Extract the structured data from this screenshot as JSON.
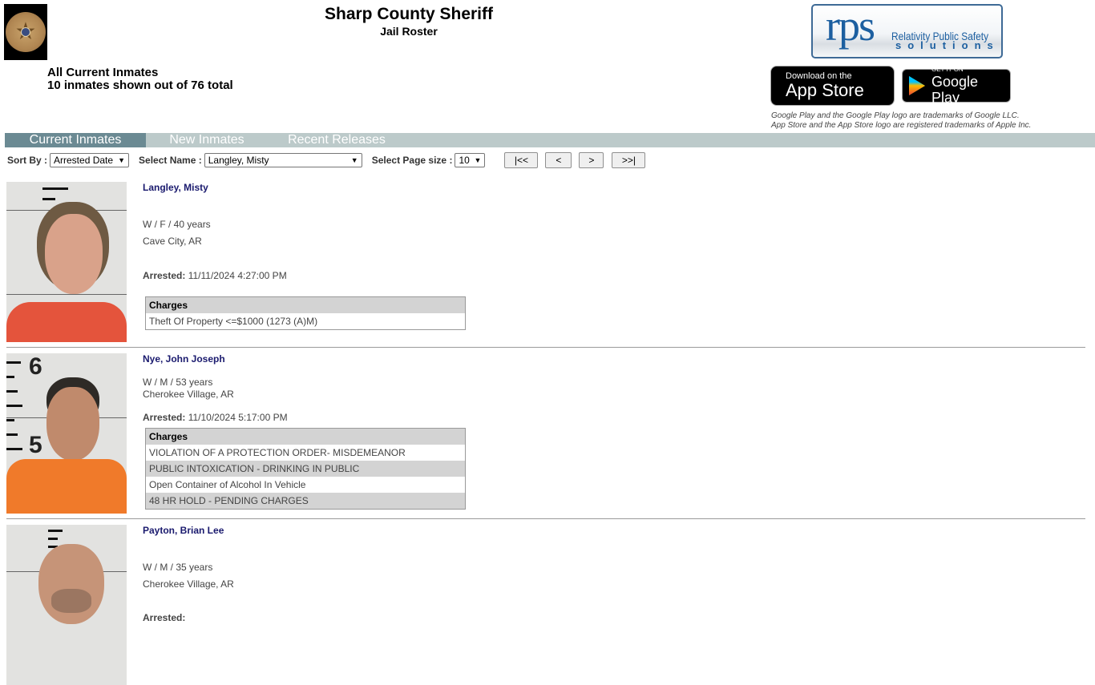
{
  "header": {
    "title": "Sharp County Sheriff",
    "subtitle": "Jail Roster",
    "summary_line1": "All Current Inmates",
    "summary_line2": "10 inmates shown out of 76 total"
  },
  "vendor": {
    "rps_big": "rps",
    "rps_line1": "Relativity Public Safety",
    "rps_line2": "solutions"
  },
  "stores": {
    "apple_small": "Download on the",
    "apple_big": "App Store",
    "google_small": "GET IT ON",
    "google_big": "Google Play",
    "trademark_1": "Google Play and the Google Play logo are trademarks of Google LLC.",
    "trademark_2": "App Store and the App Store logo are registered trademarks of Apple Inc."
  },
  "tabs": [
    {
      "label": "Current Inmates",
      "active": true
    },
    {
      "label": "New Inmates",
      "active": false
    },
    {
      "label": "Recent Releases",
      "active": false
    }
  ],
  "controls": {
    "sort_label": "Sort By :",
    "sort_value": "Arrested Date",
    "name_label": "Select Name :",
    "name_value": "Langley, Misty",
    "page_size_label": "Select Page size :",
    "page_size_value": "10",
    "first_label": "|<<",
    "prev_label": "<",
    "next_label": ">",
    "last_label": ">>|"
  },
  "inmates": [
    {
      "name": "Langley, Misty",
      "demographics": "W / F / 40 years",
      "location": "Cave City, AR",
      "arrested_label": "Arrested:",
      "arrested": "11/11/2024 4:27:00 PM",
      "charges_header": "Charges",
      "charges": [
        "Theft Of Property <=$1000 (1273 (A)M)"
      ]
    },
    {
      "name": "Nye, John Joseph",
      "demographics": "W / M / 53 years",
      "location": "Cherokee Village, AR",
      "arrested_label": "Arrested:",
      "arrested": "11/10/2024 5:17:00 PM",
      "charges_header": "Charges",
      "charges": [
        "VIOLATION OF A PROTECTION ORDER- MISDEMEANOR",
        "PUBLIC INTOXICATION - DRINKING IN PUBLIC",
        "Open Container of Alcohol In Vehicle",
        "48 HR HOLD - PENDING CHARGES"
      ]
    },
    {
      "name": "Payton, Brian Lee",
      "demographics": "W / M / 35 years",
      "location": "Cherokee Village, AR",
      "arrested_label": "Arrested:"
    }
  ]
}
